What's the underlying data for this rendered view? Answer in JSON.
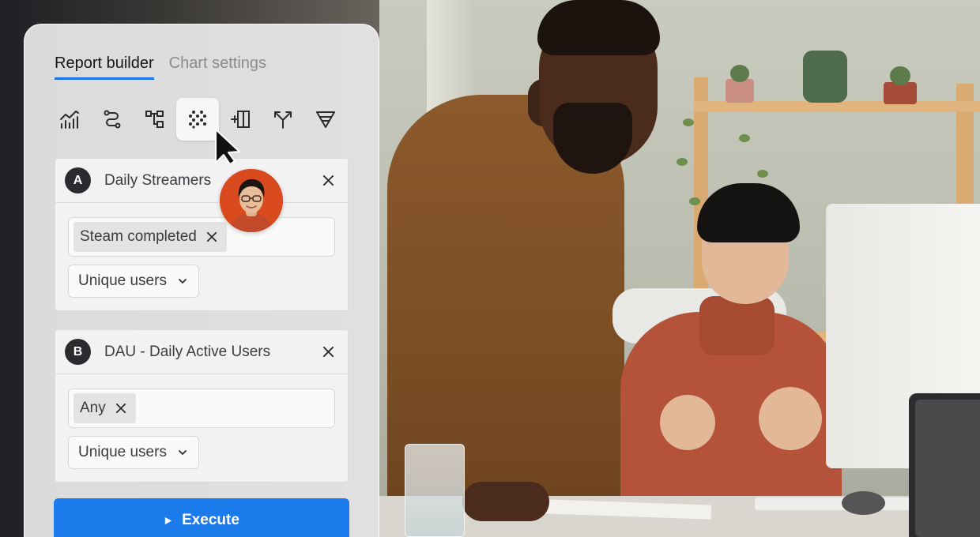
{
  "tabs": {
    "report_builder": "Report builder",
    "chart_settings": "Chart settings"
  },
  "toolbar": {
    "icons": [
      "line-chart-icon",
      "flow-icon",
      "hierarchy-icon",
      "scatter-dots-icon",
      "add-column-icon",
      "split-arrow-icon",
      "filter-icon"
    ],
    "active_index": 3
  },
  "cards": {
    "a": {
      "badge": "A",
      "title": "Daily Streamers",
      "chip": "Steam completed",
      "select": "Unique users"
    },
    "b": {
      "badge": "B",
      "title": "DAU - Daily Active Users",
      "chip": "Any",
      "select": "Unique users"
    }
  },
  "execute": {
    "label": "Execute"
  },
  "colors": {
    "accent": "#1a73e8",
    "execute_bg": "#1c7bea",
    "badge_bg": "#2a2b2e",
    "avatar_bg": "#d94a1f"
  }
}
